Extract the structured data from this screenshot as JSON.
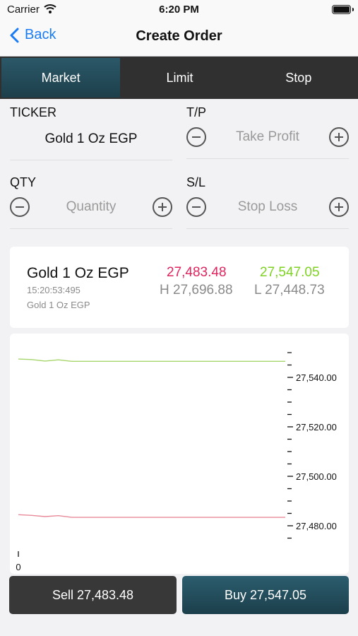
{
  "status_bar": {
    "carrier": "Carrier",
    "time": "6:20 PM",
    "wifi_icon": "wifi-icon",
    "battery_icon": "battery-icon",
    "battery_level": 1.0
  },
  "nav": {
    "back_label": "Back",
    "title": "Create Order",
    "back_icon": "chevron-left-icon",
    "accent": "#1a7cf5"
  },
  "tabs": [
    {
      "label": "Market",
      "active": true
    },
    {
      "label": "Limit",
      "active": false
    },
    {
      "label": "Stop",
      "active": false
    }
  ],
  "form": {
    "ticker_label": "TICKER",
    "ticker_value": "Gold 1 Oz EGP",
    "tp_label": "T/P",
    "tp_placeholder": "Take Profit",
    "qty_label": "QTY",
    "qty_placeholder": "Quantity",
    "sl_label": "S/L",
    "sl_placeholder": "Stop Loss",
    "minus_icon": "minus-circle-icon",
    "plus_icon": "plus-circle-icon"
  },
  "quote": {
    "name": "Gold 1 Oz EGP",
    "time": "15:20:53:495",
    "description": "Gold 1 Oz EGP",
    "bid": "27,483.48",
    "ask": "27,547.05",
    "high": "H 27,696.88",
    "low": "L 27,448.73",
    "bid_color": "#e0245e",
    "ask_color": "#7ed321"
  },
  "chart_data": {
    "type": "line",
    "x": [
      0,
      1,
      2,
      3,
      4,
      5,
      6,
      7,
      8,
      9,
      10,
      11,
      12,
      13,
      14,
      15,
      16,
      17,
      18,
      19,
      20
    ],
    "x_tick_labels": [
      "0"
    ],
    "y_tick_labels": [
      "27,540.00",
      "27,520.00",
      "27,500.00",
      "27,480.00"
    ],
    "y_ticks": [
      27540,
      27520,
      27500,
      27480
    ],
    "ylim": [
      27472,
      27552
    ],
    "grid": false,
    "series": [
      {
        "color": "#a6d66b",
        "values": [
          27547.4,
          27547.2,
          27546.6,
          27547.1,
          27546.5,
          27546.5,
          27546.5,
          27546.5,
          27546.5,
          27546.5,
          27546.5,
          27546.5,
          27546.5,
          27546.5,
          27546.5,
          27546.5,
          27546.5,
          27546.5,
          27546.5,
          27546.5,
          27546.5
        ]
      },
      {
        "color": "#e88a9a",
        "values": [
          27484.5,
          27484.2,
          27483.7,
          27484.1,
          27483.4,
          27483.4,
          27483.4,
          27483.4,
          27483.4,
          27483.4,
          27483.4,
          27483.4,
          27483.4,
          27483.4,
          27483.4,
          27483.4,
          27483.4,
          27483.4,
          27483.4,
          27483.4,
          27483.4
        ]
      }
    ]
  },
  "actions": {
    "sell_label": "Sell 27,483.48",
    "buy_label": "Buy 27,547.05"
  }
}
